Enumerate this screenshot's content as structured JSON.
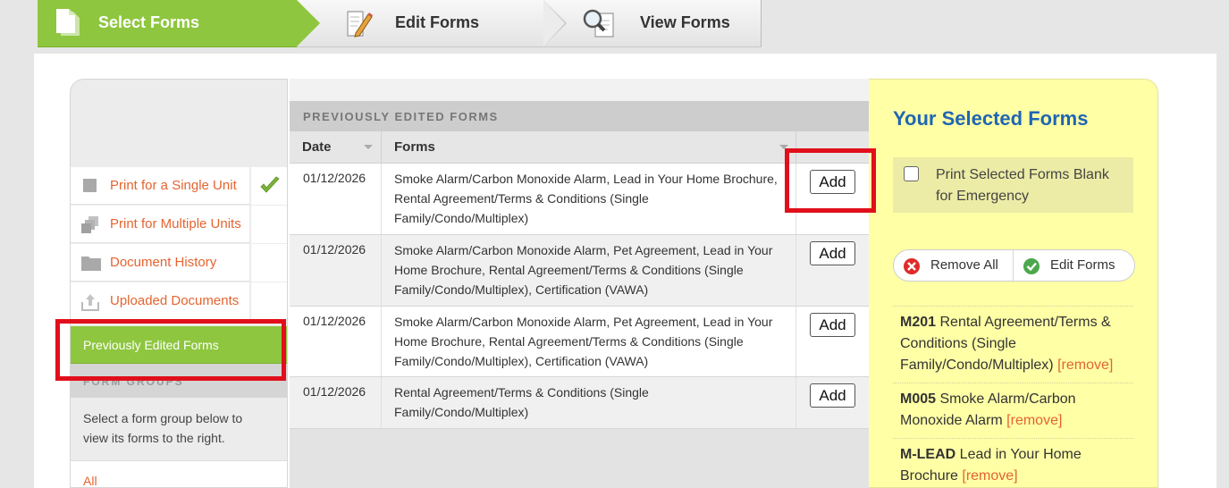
{
  "steps": [
    {
      "label": "Select Forms",
      "icon": "document-icon",
      "active": true
    },
    {
      "label": "Edit Forms",
      "icon": "pencil-icon",
      "active": false
    },
    {
      "label": "View Forms",
      "icon": "magnifier-icon",
      "active": false
    }
  ],
  "sidebar": {
    "items": [
      {
        "label": "Print for a Single Unit",
        "icon": "single-unit-icon",
        "checked": true
      },
      {
        "label": "Print for Multiple Units",
        "icon": "multiple-units-icon",
        "checked": false
      },
      {
        "label": "Document History",
        "icon": "folder-icon",
        "checked": false
      },
      {
        "label": "Uploaded Documents",
        "icon": "upload-icon",
        "checked": false
      }
    ],
    "active_item": "Previously Edited Forms",
    "form_groups_title": "FORM GROUPS",
    "form_groups_desc": "Select a form group below to view its forms to the right.",
    "form_groups": [
      "All"
    ]
  },
  "table": {
    "section_title": "PREVIOUSLY EDITED FORMS",
    "headers": {
      "date": "Date",
      "forms": "Forms"
    },
    "add_label": "Add",
    "rows": [
      {
        "date": "01/12/2026",
        "forms": "Smoke Alarm/Carbon Monoxide Alarm, Lead in Your Home Brochure, Rental Agreement/Terms & Conditions (Single Family/Condo/Multiplex)"
      },
      {
        "date": "01/12/2026",
        "forms": "Smoke Alarm/Carbon Monoxide Alarm, Pet Agreement, Lead in Your Home Brochure, Rental Agreement/Terms & Conditions (Single Family/Condo/Multiplex), Certification (VAWA)"
      },
      {
        "date": "01/12/2026",
        "forms": "Smoke Alarm/Carbon Monoxide Alarm, Pet Agreement, Lead in Your Home Brochure, Rental Agreement/Terms & Conditions (Single Family/Condo/Multiplex), Certification (VAWA)"
      },
      {
        "date": "01/12/2026",
        "forms": "Rental Agreement/Terms & Conditions (Single Family/Condo/Multiplex)"
      }
    ]
  },
  "selected": {
    "title": "Your Selected Forms",
    "blank_label": "Print Selected Forms Blank for Emergency",
    "remove_all_label": "Remove All",
    "edit_forms_label": "Edit Forms",
    "remove_link": "[remove]",
    "items": [
      {
        "code": "M201",
        "name": "Rental Agreement/Terms & Conditions (Single Family/Condo/Multiplex)"
      },
      {
        "code": "M005",
        "name": "Smoke Alarm/Carbon Monoxide Alarm"
      },
      {
        "code": "M-LEAD",
        "name": "Lead in Your Home Brochure"
      }
    ]
  },
  "colors": {
    "accent_green": "#8ec63f",
    "link_orange": "#e4642f",
    "title_blue": "#1f66b3",
    "panel_yellow": "#ffffa6",
    "highlight_red": "#e10f1b"
  }
}
